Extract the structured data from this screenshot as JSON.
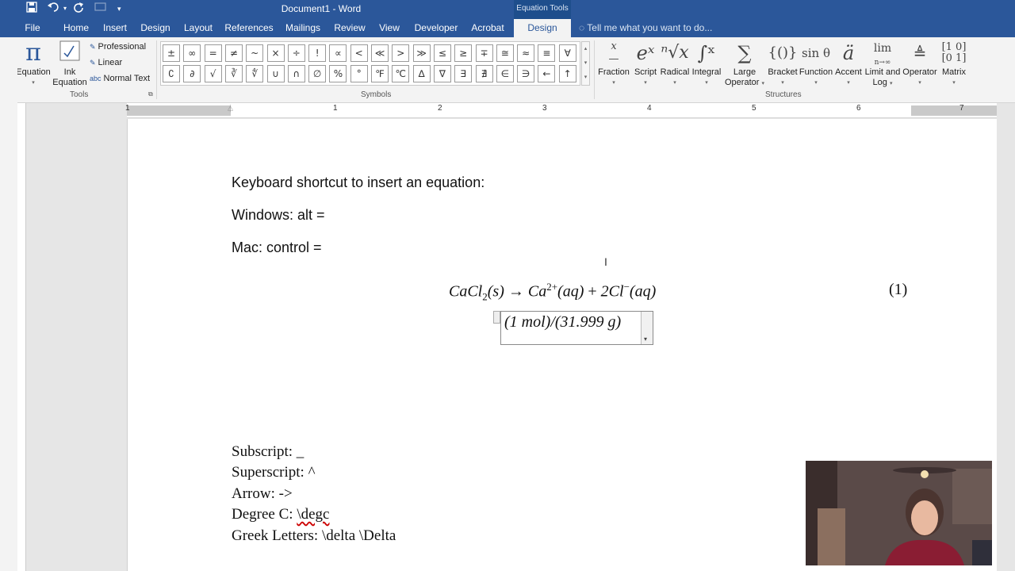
{
  "title_bar": {
    "doc_title": "Document1 - Word",
    "context_label": "Equation Tools"
  },
  "tabs": [
    "File",
    "Home",
    "Insert",
    "Design",
    "Layout",
    "References",
    "Mailings",
    "Review",
    "View",
    "Developer",
    "Acrobat",
    "Design"
  ],
  "tell_me": "Tell me what you want to do...",
  "tools_group": {
    "equation_label": "Equation",
    "ink_label_1": "Ink",
    "ink_label_2": "Equation",
    "professional": "Professional",
    "linear": "Linear",
    "normal_text": "Normal Text",
    "normal_text_prefix": "abc",
    "group_label": "Tools"
  },
  "symbols": {
    "row1": [
      "±",
      "∞",
      "=",
      "≠",
      "~",
      "×",
      "÷",
      "!",
      "∝",
      "<",
      "≪",
      ">",
      "≫",
      "≤",
      "≥",
      "∓",
      "≅",
      "≈",
      "≡",
      "∀"
    ],
    "row2": [
      "∁",
      "∂",
      "√",
      "∛",
      "∜",
      "∪",
      "∩",
      "∅",
      "%",
      "°",
      "℉",
      "℃",
      "∆",
      "∇",
      "∃",
      "∄",
      "∈",
      "∋",
      "←",
      "↑"
    ],
    "group_label": "Symbols"
  },
  "structures": {
    "items": [
      {
        "label": "Fraction",
        "icon": "fraction-icon",
        "glyph": "x/y"
      },
      {
        "label": "Script",
        "icon": "script-icon",
        "glyph": "eˣ"
      },
      {
        "label": "Radical",
        "icon": "radical-icon",
        "glyph": "ⁿ√x"
      },
      {
        "label": "Integral",
        "icon": "integral-icon",
        "glyph": "∫"
      },
      {
        "label": "Large",
        "label2": "Operator",
        "icon": "large-operator-icon",
        "glyph": "∑"
      },
      {
        "label": "Bracket",
        "icon": "bracket-icon",
        "glyph": "{()}"
      },
      {
        "label": "Function",
        "icon": "function-icon",
        "glyph": "sinθ"
      },
      {
        "label": "Accent",
        "icon": "accent-icon",
        "glyph": "ä"
      },
      {
        "label": "Limit and",
        "label2": "Log",
        "icon": "limit-icon",
        "glyph": "lim"
      },
      {
        "label": "Operator",
        "icon": "operator-icon",
        "glyph": "Δ"
      },
      {
        "label": "Matrix",
        "icon": "matrix-icon",
        "glyph": "[10]"
      }
    ],
    "group_label": "Structures"
  },
  "ruler": [
    "1",
    "1",
    "2",
    "3",
    "4",
    "5",
    "6",
    "7"
  ],
  "document": {
    "line1": "Keyboard shortcut to insert an equation:",
    "line2": "Windows: alt =",
    "line3": "Mac: control =",
    "eq_number": "(1)",
    "equation1": {
      "ca_cl": "CaCl",
      "sub2": "2",
      "state_s": "(s)",
      "arrow": "→",
      "ca": "Ca",
      "charge": "2+",
      "aq1": "(aq)",
      "plus": "+",
      "two_cl": "2Cl",
      "minus": "−",
      "aq2": "(aq)"
    },
    "equation2": "(1 mol)/(31.999 g)",
    "sub": "Subscript: _",
    "sup": "Superscript: ^",
    "arrow": "Arrow: ->",
    "deg_prefix": "Degree C: ",
    "deg_cmd": "\\degc",
    "greek": "Greek Letters: \\delta \\Delta"
  },
  "colors": {
    "brand": "#2b579a",
    "ribbon": "#f3f3f3"
  }
}
